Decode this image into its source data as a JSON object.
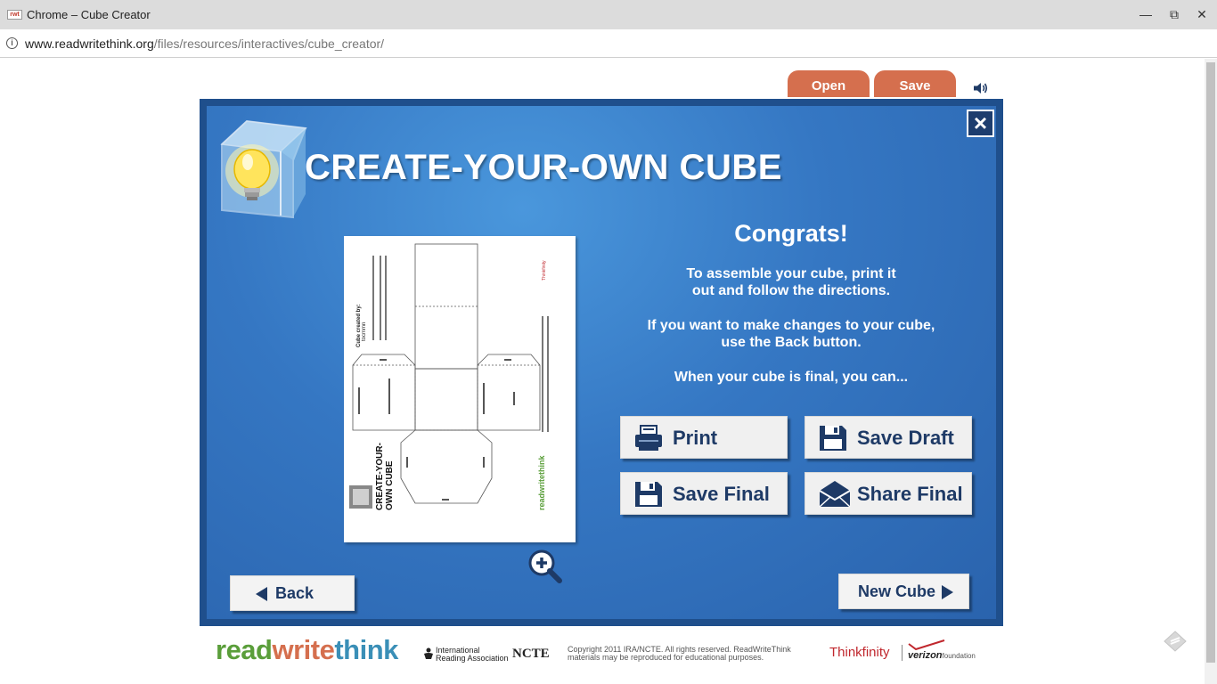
{
  "browser": {
    "favicon_text": "rwt",
    "title": "Chrome – Cube Creator",
    "url_host": "www.readwritethink.org",
    "url_path": "/files/resources/interactives/cube_creator/"
  },
  "toolbar": {
    "open_label": "Open",
    "save_label": "Save"
  },
  "header": {
    "title": "CREATE-YOUR-OWN CUBE"
  },
  "message": {
    "heading": "Congrats!",
    "line1": "To assemble your cube, print it",
    "line2": "out and follow the directions.",
    "line3": "If you want to make changes to your cube,",
    "line4": "use the Back button.",
    "line5": "When your cube is final, you can..."
  },
  "actions": {
    "print": "Print",
    "save_draft": "Save Draft",
    "save_final": "Save Final",
    "share_final": "Share Final"
  },
  "nav": {
    "back": "Back",
    "new_cube": "New Cube"
  },
  "preview": {
    "created_by": "Cube created by:",
    "author": "tocmmn",
    "brand_title_1": "CREATE-YOUR-",
    "brand_title_2": "OWN CUBE",
    "brand": "readwritethink"
  },
  "footer": {
    "logo_read": "read",
    "logo_write": "write",
    "logo_think": "think",
    "ira_line1": "International",
    "ira_line2": "Reading Association",
    "ncte": "NCTE",
    "copyright_line1": "Copyright 2011 IRA/NCTE. All rights reserved. ReadWriteThink",
    "copyright_line2": "materials may be reproduced for educational purposes.",
    "thinkfinity": "Thinkfinity",
    "verizon": "verizon",
    "verizon_foundation": "foundation"
  },
  "colors": {
    "tab": "#d56f4e",
    "panel_border": "#1f4f8c",
    "panel_bg": "#3577c3",
    "button_text": "#1e3a66"
  }
}
